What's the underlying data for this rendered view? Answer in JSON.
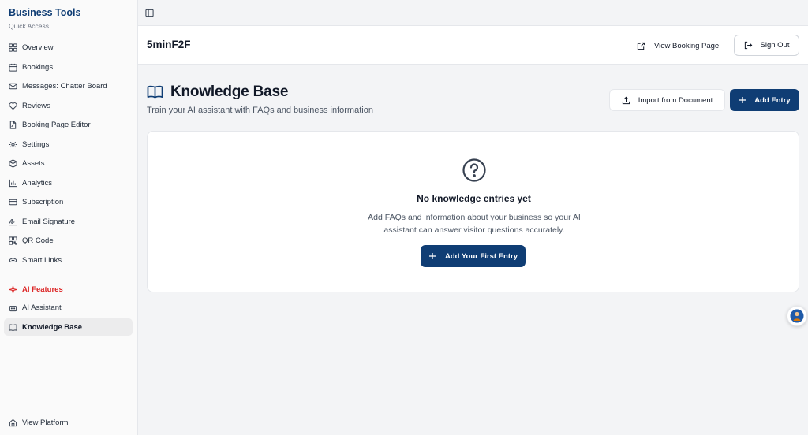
{
  "sidebar": {
    "brand_title": "Business Tools",
    "brand_subtitle": "Quick Access",
    "items": [
      {
        "label": "Overview",
        "icon": "grid-icon"
      },
      {
        "label": "Bookings",
        "icon": "calendar-icon"
      },
      {
        "label": "Messages: Chatter Board",
        "icon": "mail-icon"
      },
      {
        "label": "Reviews",
        "icon": "heart-icon"
      },
      {
        "label": "Booking Page Editor",
        "icon": "file-edit-icon"
      },
      {
        "label": "Settings",
        "icon": "gear-icon"
      },
      {
        "label": "Assets",
        "icon": "box-icon"
      },
      {
        "label": "Analytics",
        "icon": "bar-chart-icon"
      },
      {
        "label": "Subscription",
        "icon": "credit-card-icon"
      },
      {
        "label": "Email Signature",
        "icon": "signature-icon"
      },
      {
        "label": "QR Code",
        "icon": "qr-code-icon"
      },
      {
        "label": "Smart Links",
        "icon": "link-icon"
      }
    ],
    "ai_section_label": "AI Features",
    "ai_items": [
      {
        "label": "AI Assistant",
        "icon": "bot-icon"
      },
      {
        "label": "Knowledge Base",
        "icon": "book-icon",
        "active": true
      }
    ],
    "footer_item": {
      "label": "View Platform",
      "icon": "home-icon"
    }
  },
  "header": {
    "title": "5minF2F",
    "view_booking_label": "View Booking Page",
    "sign_out_label": "Sign Out"
  },
  "page": {
    "title": "Knowledge Base",
    "subtitle": "Train your AI assistant with FAQs and business information",
    "import_label": "Import from Document",
    "add_label": "Add Entry"
  },
  "empty_state": {
    "title": "No knowledge entries yet",
    "description": "Add FAQs and information about your business so your AI assistant can answer visitor questions accurately.",
    "button_label": "Add Your First Entry"
  },
  "colors": {
    "brand": "#0f3d74",
    "ai_accent": "#dc2626"
  }
}
